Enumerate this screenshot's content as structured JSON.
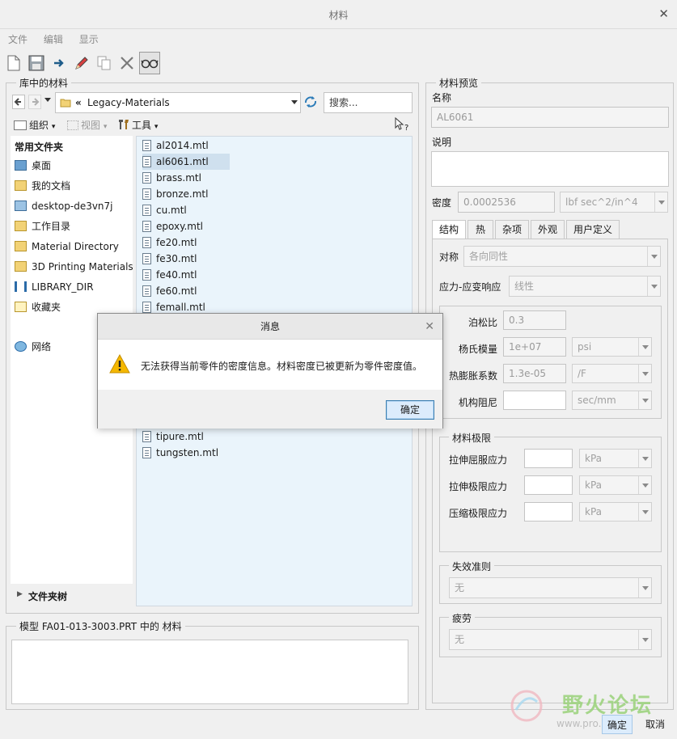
{
  "window": {
    "title": "材料",
    "close_glyph": "✕"
  },
  "menu": [
    "文件",
    "编辑",
    "显示"
  ],
  "toolbar": [
    "new-icon",
    "save-icon",
    "arrow-icon",
    "edit-icon",
    "copy-icon",
    "delete-icon",
    "glasses-icon"
  ],
  "library": {
    "label": "库中的材料",
    "path": "Legacy-Materials",
    "path_prefix": "«",
    "search_placeholder": "搜索...",
    "organize_label": "组织",
    "view_label": "视图",
    "tools_label": "工具",
    "help_glyph": "?"
  },
  "nav": {
    "header": "常用文件夹",
    "items": [
      {
        "label": "桌面"
      },
      {
        "label": "我的文档"
      },
      {
        "label": "desktop-de3vn7j"
      },
      {
        "label": "工作目录"
      },
      {
        "label": "Material Directory"
      },
      {
        "label": "3D Printing Materials"
      },
      {
        "label": "LIBRARY_DIR"
      },
      {
        "label": "收藏夹"
      },
      {
        "label": "网络"
      }
    ],
    "tree_label": "文件夹树"
  },
  "files": [
    "al2014.mtl",
    "al6061.mtl",
    "brass.mtl",
    "bronze.mtl",
    "cu.mtl",
    "epoxy.mtl",
    "fe20.mtl",
    "fe30.mtl",
    "fe40.mtl",
    "fe60.mtl",
    "femall.mtl",
    "tipure.mtl",
    "tungsten.mtl"
  ],
  "model": {
    "label": "模型 FA01-013-3003.PRT 中的 材料"
  },
  "preview": {
    "label": "材料预览",
    "name_label": "名称",
    "name_value": "AL6061",
    "desc_label": "说明",
    "density_label": "密度",
    "density_value": "0.0002536",
    "density_unit": "lbf sec^2/in^4",
    "tabs": [
      "结构",
      "热",
      "杂项",
      "外观",
      "用户定义"
    ],
    "symmetry_label": "对称",
    "symmetry_value": "各向同性",
    "stress_label": "应力-应变响应",
    "stress_value": "线性",
    "poisson_label": "泊松比",
    "poisson_value": "0.3",
    "young_label": "杨氏模量",
    "young_value": "1e+07",
    "young_unit": "psi",
    "thermal_label": "热膨胀系数",
    "thermal_value": "1.3e-05",
    "thermal_unit": "/F",
    "damping_label": "机构阻尼",
    "damping_value": "",
    "damping_unit": "sec/mm",
    "limits_label": "材料极限",
    "tensile_yield_label": "拉伸屈服应力",
    "tensile_ultimate_label": "拉伸极限应力",
    "compressive_label": "压缩极限应力",
    "limit_unit": "kPa",
    "failure_label": "失效准则",
    "failure_value": "无",
    "fatigue_label": "疲劳",
    "fatigue_value": "无"
  },
  "dialog": {
    "title": "消息",
    "close_glyph": "✕",
    "message": "无法获得当前零件的密度信息。材料密度已被更新为零件密度值。",
    "ok_label": "确定"
  },
  "buttons": {
    "ok": "确定",
    "cancel": "取消"
  },
  "watermark": {
    "text": "野火论坛",
    "url_fragment": "www.pro..."
  },
  "colors": {
    "accent": "#3c7fb1",
    "selection": "#cfe0ee",
    "warning": "#f5b800",
    "watermark": "#9ad27a"
  }
}
